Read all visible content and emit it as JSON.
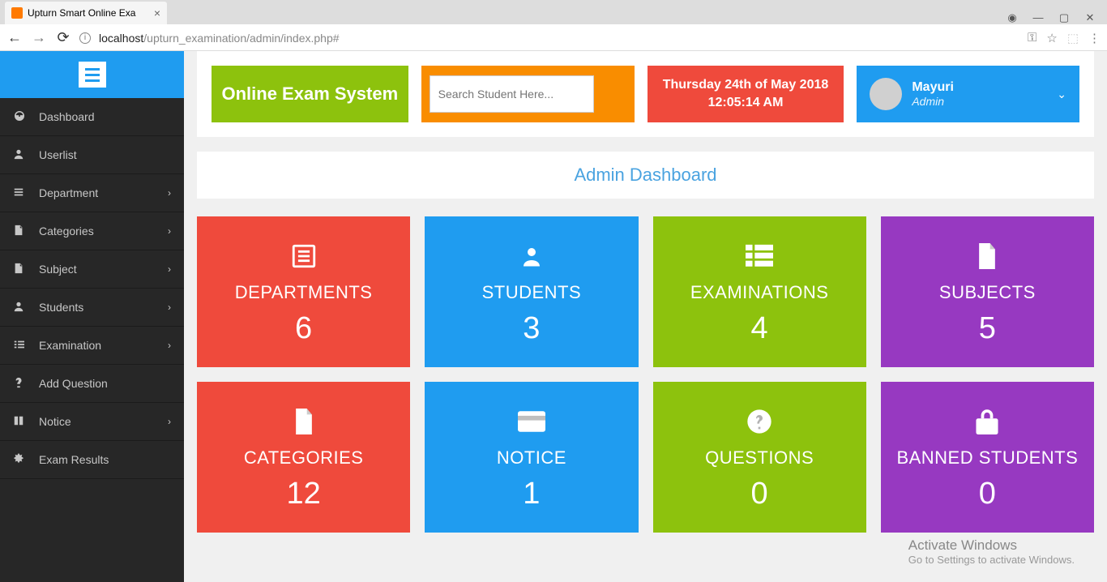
{
  "browser": {
    "tab_title": "Upturn Smart Online Exa",
    "url_host": "localhost",
    "url_path": "/upturn_examination/admin/index.php#"
  },
  "sidebar": {
    "items": [
      {
        "label": "Dashboard",
        "expandable": false
      },
      {
        "label": "Userlist",
        "expandable": false
      },
      {
        "label": "Department",
        "expandable": true
      },
      {
        "label": "Categories",
        "expandable": true
      },
      {
        "label": "Subject",
        "expandable": true
      },
      {
        "label": "Students",
        "expandable": true
      },
      {
        "label": "Examination",
        "expandable": true
      },
      {
        "label": "Add Question",
        "expandable": false
      },
      {
        "label": "Notice",
        "expandable": true
      },
      {
        "label": "Exam Results",
        "expandable": false
      }
    ]
  },
  "header": {
    "brand": "Online Exam System",
    "search_placeholder": "Search Student Here...",
    "date_line1": "Thursday 24th of May 2018",
    "date_line2": "12:05:14 AM",
    "user_name": "Mayuri",
    "user_role": "Admin"
  },
  "page_title": "Admin Dashboard",
  "cards": [
    {
      "label": "DEPARTMENTS",
      "value": "6",
      "color": "red",
      "icon": "list"
    },
    {
      "label": "STUDENTS",
      "value": "3",
      "color": "blue",
      "icon": "user"
    },
    {
      "label": "EXAMINATIONS",
      "value": "4",
      "color": "green",
      "icon": "grid"
    },
    {
      "label": "SUBJECTS",
      "value": "5",
      "color": "purple",
      "icon": "file"
    },
    {
      "label": "CATEGORIES",
      "value": "12",
      "color": "red",
      "icon": "file"
    },
    {
      "label": "NOTICE",
      "value": "1",
      "color": "blue",
      "icon": "card"
    },
    {
      "label": "QUESTIONS",
      "value": "0",
      "color": "green",
      "icon": "question"
    },
    {
      "label": "BANNED STUDENTS",
      "value": "0",
      "color": "purple",
      "icon": "lock"
    }
  ],
  "watermark": {
    "title": "Activate Windows",
    "sub": "Go to Settings to activate Windows."
  }
}
